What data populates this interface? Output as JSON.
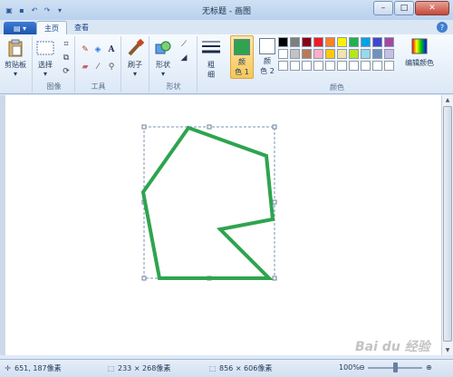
{
  "window": {
    "title": "无标题 - 画图"
  },
  "tabs": {
    "app_menu_label": "▤ ▾",
    "home": "主页",
    "view": "查看"
  },
  "ribbon": {
    "clipboard": {
      "label": "剪贴板",
      "group": ""
    },
    "image": {
      "select": "选择",
      "group": "图像"
    },
    "tools": {
      "group": "工具",
      "text_tool": "A"
    },
    "brushes": {
      "label": "刷子"
    },
    "shapes": {
      "label": "形状",
      "group": "形状"
    },
    "size": {
      "label": "粗\n细"
    },
    "color1": {
      "label": "颜\n色 1",
      "value": "#2ea44f"
    },
    "color2": {
      "label": "颜\n色 2",
      "value": "#ffffff"
    },
    "colors_group": "颜色",
    "edit_colors": "编辑颜色",
    "palette": [
      "#000000",
      "#7f7f7f",
      "#880015",
      "#ed1c24",
      "#ff7f27",
      "#fff200",
      "#22b14c",
      "#00a2e8",
      "#3f48cc",
      "#a349a4",
      "#ffffff",
      "#c3c3c3",
      "#b97a57",
      "#ffaec9",
      "#ffc90e",
      "#efe4b0",
      "#b5e61d",
      "#99d9ea",
      "#7092be",
      "#c8bfe7",
      "#ffffff",
      "#ffffff",
      "#ffffff",
      "#ffffff",
      "#ffffff",
      "#ffffff",
      "#ffffff",
      "#ffffff",
      "#ffffff",
      "#ffffff"
    ]
  },
  "canvas": {
    "stroke_color": "#2ea44f"
  },
  "status": {
    "cursor": "651, 187像素",
    "selection": "233 × 268像素",
    "image_size": "856 × 606像素",
    "zoom": "100%"
  }
}
